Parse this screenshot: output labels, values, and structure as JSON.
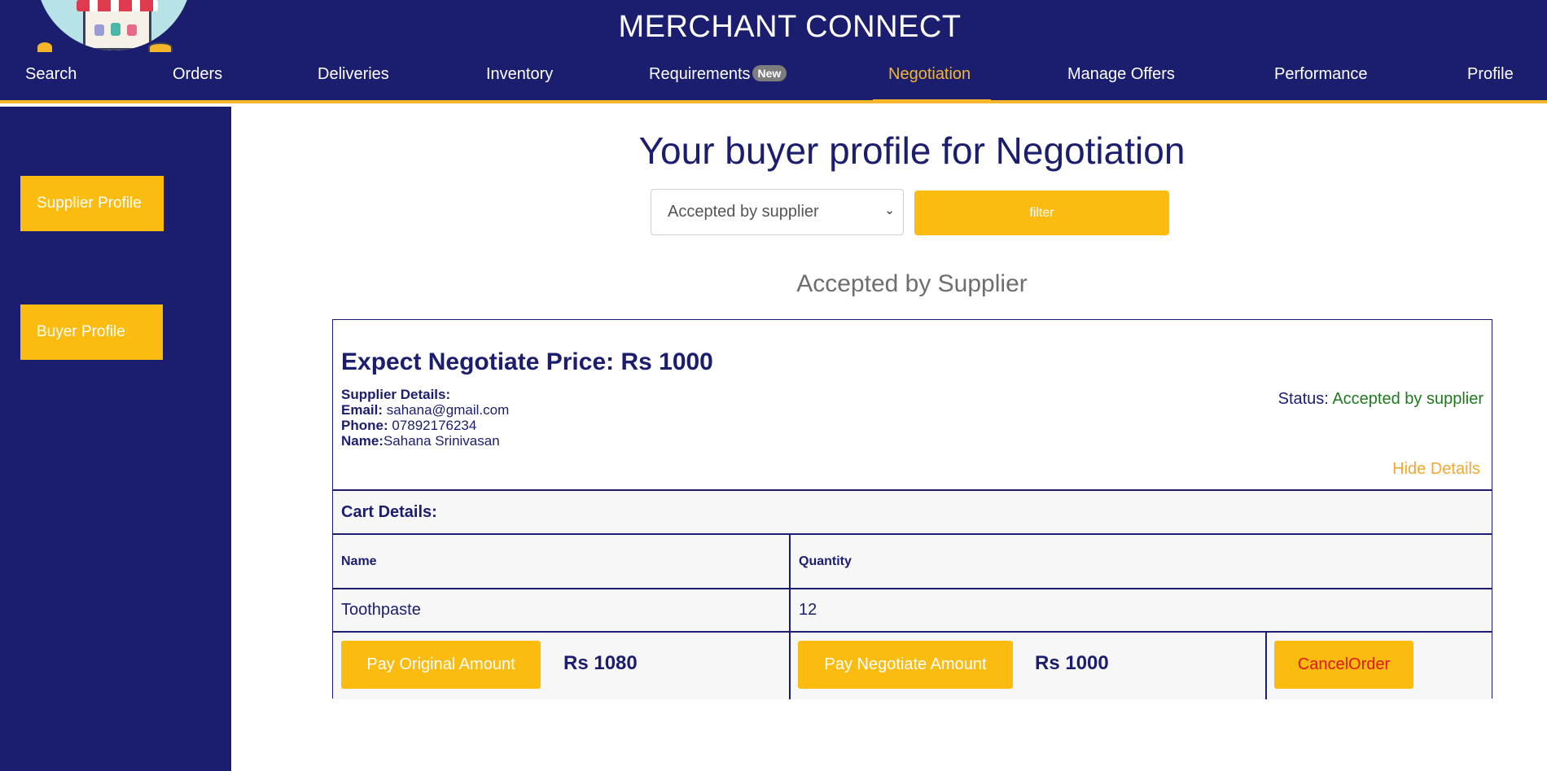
{
  "header": {
    "app_title": "MERCHANT CONNECT",
    "nav": [
      {
        "label": "Search"
      },
      {
        "label": "Orders"
      },
      {
        "label": "Deliveries"
      },
      {
        "label": "Inventory"
      },
      {
        "label": "Requirements",
        "badge": "New"
      },
      {
        "label": "Negotiation",
        "active": true
      },
      {
        "label": "Manage Offers"
      },
      {
        "label": "Performance"
      },
      {
        "label": "Profile"
      }
    ]
  },
  "sidebar": {
    "items": [
      {
        "label": "Supplier Profile"
      },
      {
        "label": "Buyer Profile"
      }
    ]
  },
  "main": {
    "title": "Your buyer profile for Negotiation",
    "filter": {
      "selected": "Accepted by supplier",
      "button_label": "filter"
    },
    "section_title": "Accepted by Supplier"
  },
  "card": {
    "expect_label": "Expect Negotiate Price: Rs 1000",
    "supplier_heading": "Supplier Details:",
    "email_label": "Email:",
    "email": "sahana@gmail.com",
    "phone_label": "Phone:",
    "phone": "07892176234",
    "name_label": "Name:",
    "name": "Sahana Srinivasan",
    "status_label": "Status:",
    "status_value": "Accepted by supplier",
    "hide_details": "Hide Details",
    "cart_heading": "Cart Details:",
    "columns": [
      "Name",
      "Quantity"
    ],
    "items": [
      {
        "name": "Toothpaste",
        "quantity": "12"
      }
    ],
    "pay_original_label": "Pay Original Amount",
    "original_amount": "Rs 1080",
    "pay_negotiate_label": "Pay Negotiate Amount",
    "negotiate_amount": "Rs 1000",
    "cancel_label": "CancelOrder"
  },
  "colors": {
    "navy": "#1b1d6e",
    "accent": "#fbbb0f",
    "status_green": "#1f7a1f",
    "cancel_red": "#e0161b",
    "link_orange": "#f0a830"
  }
}
